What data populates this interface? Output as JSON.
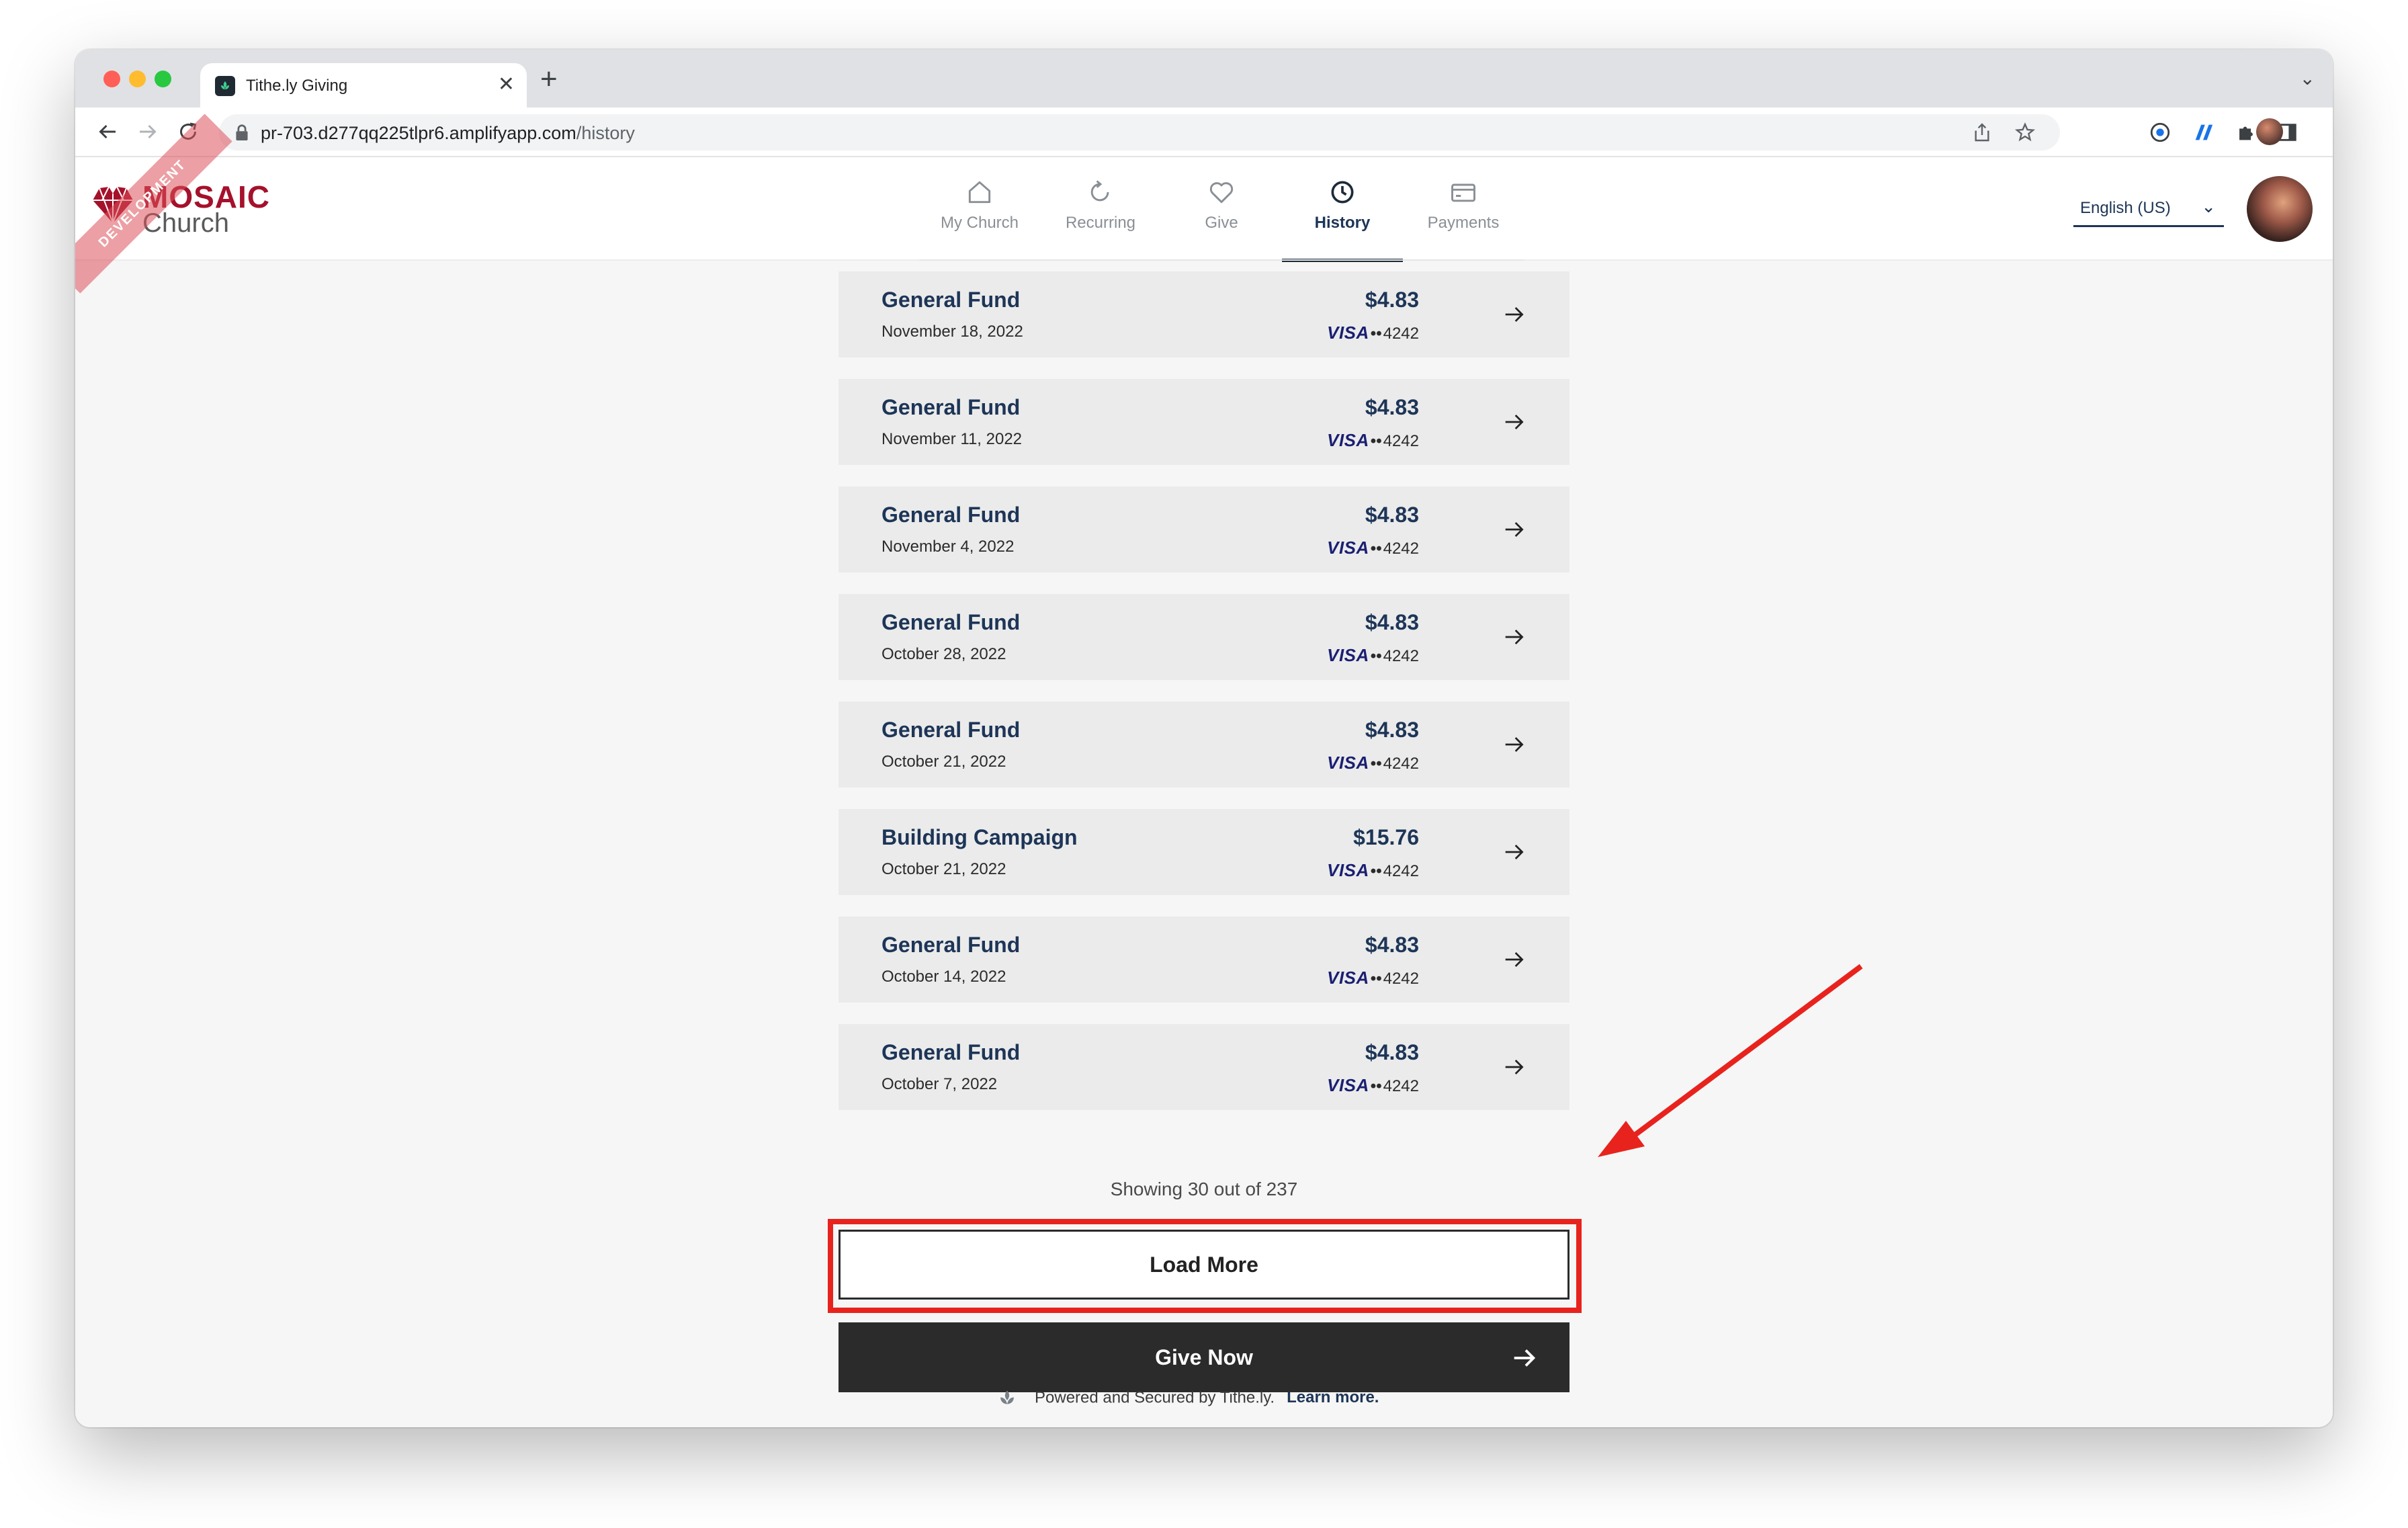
{
  "browser": {
    "tab_title": "Tithe.ly Giving",
    "url_host": "pr-703.d277qq225tlpr6.amplifyapp.com",
    "url_path": "/history",
    "new_tab_glyph": "+",
    "close_glyph": "✕",
    "dropdown_glyph": "⌄"
  },
  "brand": {
    "name_line1": "MOSAIC",
    "name_line2": "Church",
    "ribbon": "DEVELOPMENT",
    "accent_color": "#a5112b"
  },
  "nav": {
    "items": [
      {
        "label": "My Church",
        "icon": "home-icon"
      },
      {
        "label": "Recurring",
        "icon": "refresh-icon"
      },
      {
        "label": "Give",
        "icon": "heart-icon"
      },
      {
        "label": "History",
        "icon": "clock-icon",
        "active": true
      },
      {
        "label": "Payments",
        "icon": "card-icon"
      }
    ]
  },
  "language": {
    "selected": "English (US)"
  },
  "history": {
    "rows": [
      {
        "fund": "General Fund",
        "date": "November 18, 2022",
        "amount": "$4.83",
        "card_brand": "VISA",
        "card_dots": "••",
        "card_last4": "4242"
      },
      {
        "fund": "General Fund",
        "date": "November 11, 2022",
        "amount": "$4.83",
        "card_brand": "VISA",
        "card_dots": "••",
        "card_last4": "4242"
      },
      {
        "fund": "General Fund",
        "date": "November 4, 2022",
        "amount": "$4.83",
        "card_brand": "VISA",
        "card_dots": "••",
        "card_last4": "4242"
      },
      {
        "fund": "General Fund",
        "date": "October 28, 2022",
        "amount": "$4.83",
        "card_brand": "VISA",
        "card_dots": "••",
        "card_last4": "4242"
      },
      {
        "fund": "General Fund",
        "date": "October 21, 2022",
        "amount": "$4.83",
        "card_brand": "VISA",
        "card_dots": "••",
        "card_last4": "4242"
      },
      {
        "fund": "Building Campaign",
        "date": "October 21, 2022",
        "amount": "$15.76",
        "card_brand": "VISA",
        "card_dots": "••",
        "card_last4": "4242"
      },
      {
        "fund": "General Fund",
        "date": "October 14, 2022",
        "amount": "$4.83",
        "card_brand": "VISA",
        "card_dots": "••",
        "card_last4": "4242"
      },
      {
        "fund": "General Fund",
        "date": "October 7, 2022",
        "amount": "$4.83",
        "card_brand": "VISA",
        "card_dots": "••",
        "card_last4": "4242"
      }
    ],
    "showing_text": "Showing 30 out of 237",
    "load_more_label": "Load More",
    "give_now_label": "Give Now"
  },
  "footer": {
    "text": "Powered and Secured by Tithe.ly.",
    "link": "Learn more."
  },
  "annotation": {
    "color": "#e8231d"
  }
}
